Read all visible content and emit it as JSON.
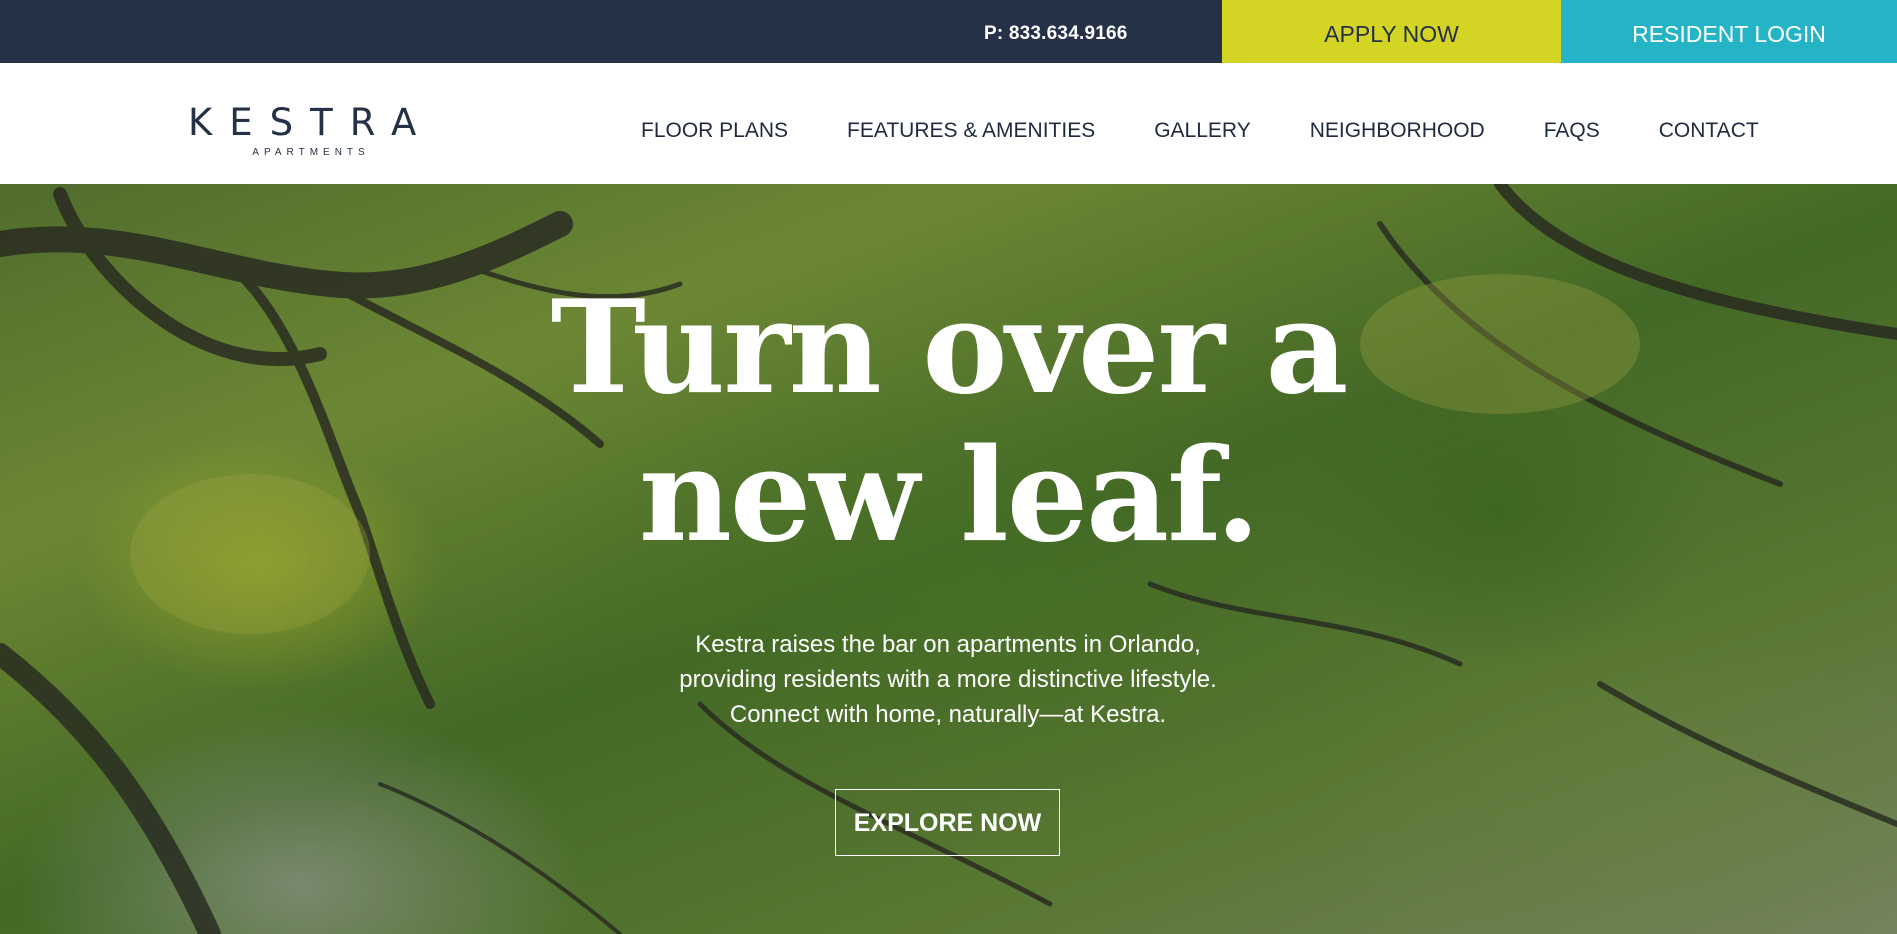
{
  "topbar": {
    "phone": "P: 833.634.9166",
    "apply_label": "APPLY NOW",
    "login_label": "RESIDENT LOGIN"
  },
  "logo": {
    "name": "KESTRA",
    "sub": "APARTMENTS"
  },
  "nav": {
    "items": [
      {
        "label": "FLOOR PLANS"
      },
      {
        "label": "FEATURES & AMENITIES"
      },
      {
        "label": "GALLERY"
      },
      {
        "label": "NEIGHBORHOOD"
      },
      {
        "label": "FAQS"
      },
      {
        "label": "CONTACT"
      }
    ]
  },
  "hero": {
    "title_line1": "Turn over a",
    "title_line2": "new leaf.",
    "text": "Kestra raises the bar on apartments in Orlando, providing residents with a more distinctive lifestyle. Connect with home, naturally—at Kestra.",
    "cta_label": "EXPLORE NOW"
  },
  "colors": {
    "navy": "#243147",
    "lime": "#d4d424",
    "teal": "#25b4c6"
  }
}
